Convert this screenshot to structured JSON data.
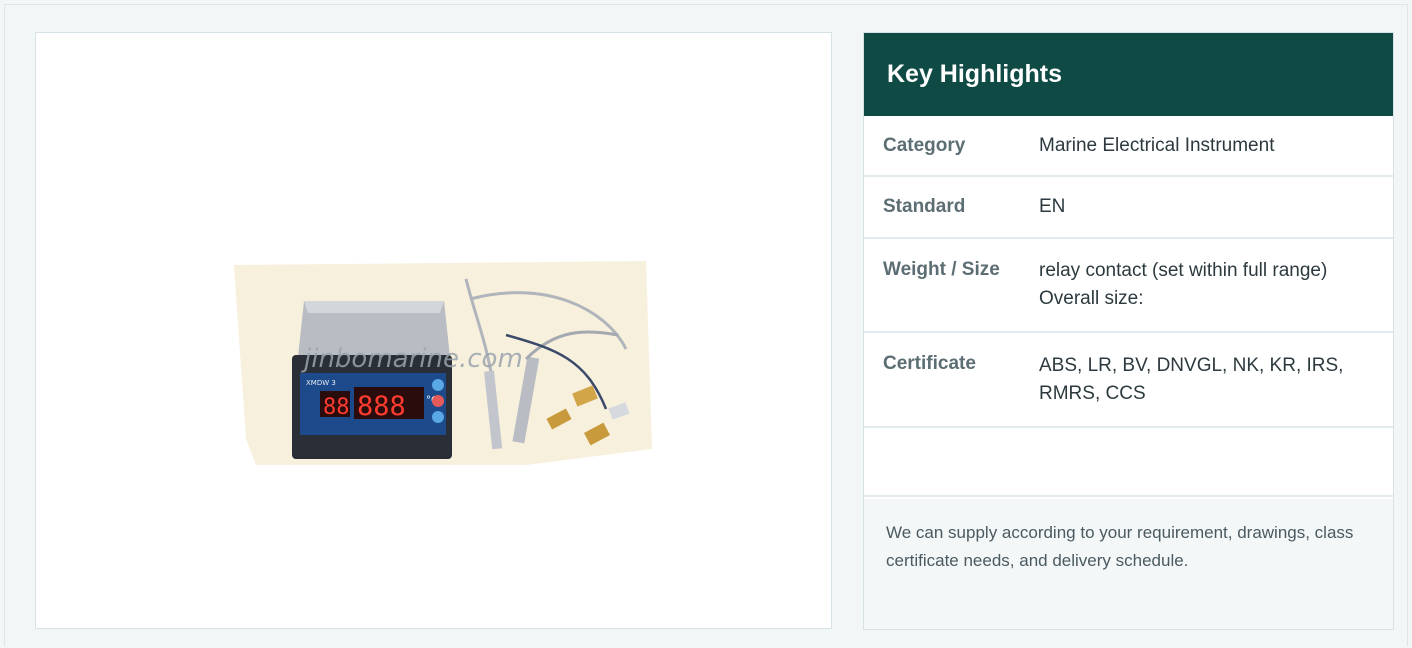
{
  "product": {
    "image_alt": "Marine temperature controller with sensors",
    "watermark": "jinbomarine.com",
    "display_model": "XMDW 3"
  },
  "highlights": {
    "title": "Key Highlights",
    "rows": [
      {
        "label": "Category",
        "value": "Marine Electrical Instrument"
      },
      {
        "label": "Standard",
        "value": "EN"
      },
      {
        "label": "Weight / Size",
        "value": "relay contact (set within full range) Overall size:"
      },
      {
        "label": "Certificate",
        "value": "ABS, LR, BV, DNVGL, NK, KR, IRS, RMRS, CCS"
      }
    ],
    "note": "We can supply according to your requirement, drawings, class certificate needs, and delivery schedule."
  },
  "colors": {
    "header_bg": "#0f4a45",
    "page_bg": "#f2f6f7",
    "led": "#ff3b2f"
  }
}
